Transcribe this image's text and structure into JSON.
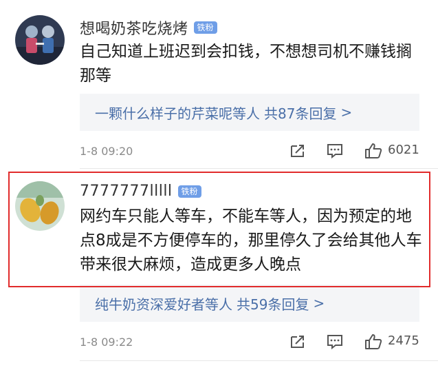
{
  "comments": [
    {
      "username": "想喝奶茶吃烧烤",
      "badge": "铁粉",
      "text": "自己知道上班迟到会扣钱，不想想司机不赚钱搁那等",
      "replies": {
        "users": "一颗什么样子的芹菜呢等人",
        "count_text": "共87条回复",
        "chevron": ">"
      },
      "time": "1-8 09:20",
      "likes": "6021",
      "avatar_colors": {
        "bg": "#2f3a52",
        "accent": "#c84c6a"
      }
    },
    {
      "username": "7777777lllll",
      "badge": "铁粉",
      "text": "网约车只能人等车，不能车等人，因为预定的地点8成是不方便停车的，那里停久了会给其他人车带来很大麻烦，造成更多人晚点",
      "replies": {
        "users": "纯牛奶资深爱好者等人",
        "count_text": "共59条回复",
        "chevron": ">"
      },
      "time": "1-8 09:22",
      "likes": "2475",
      "avatar_colors": {
        "bg": "#cfe0d4",
        "accent": "#e3b33a"
      }
    }
  ],
  "icons": [
    "share-icon",
    "comment-icon",
    "like-icon"
  ],
  "colors": {
    "highlight": "#e12b2b",
    "badge": "#6f9ee7",
    "reply_link": "#4a6fa8"
  }
}
